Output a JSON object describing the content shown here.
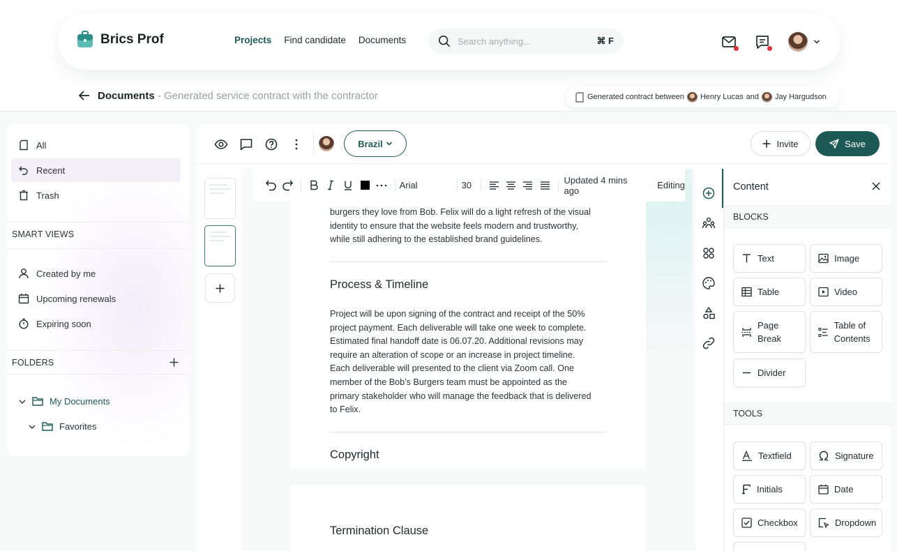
{
  "app": {
    "brand": "Brics Prof",
    "nav": [
      "Projects",
      "Find candidate",
      "Documents"
    ],
    "nav_active": 0,
    "search_placeholder": "Search anything...",
    "search_shortcut": "⌘ F"
  },
  "breadcrumb": {
    "title": "Documents",
    "subtitle": " - Generated service contract with the contractor"
  },
  "contract": {
    "prefix": "Generated contract between",
    "person1": "Henry Lucas",
    "and": "and",
    "person2": "Jay Hargudson"
  },
  "sidebar": {
    "items": [
      "All",
      "Recent",
      "Trash"
    ],
    "active": 1,
    "smart_views_title": "SMART VIEWS",
    "smart_views": [
      "Created by me",
      "Upcoming renewals",
      "Expiring soon"
    ],
    "folders_title": "FOLDERS",
    "folders": [
      "My Documents",
      "Favorites"
    ]
  },
  "toolbar": {
    "country": "Brazil",
    "invite": "Invite",
    "save": "Save"
  },
  "format_bar": {
    "font": "Arial",
    "size": "30",
    "updated": "Updated 4 mins ago",
    "mode": "Editing"
  },
  "document": {
    "intro_lines": [
      "burgers they love from Bob. Felix will do a light refresh of the visual",
      "identity to ensure that the website feels modern and trustworthy,",
      "while still adhering to the established brand guidelines."
    ],
    "section1_title": "Process & Timeline",
    "section1_lines": [
      "Project will be upon signing of the contract and receipt of the 50%",
      "project payment. Each deliverable will take one week to complete.",
      "Estimated final handoff date is 06.07.20. Additional revisions may",
      "require an alteration of scope or an increase in project timeline.",
      "Each deliverable will presented to the client via Zoom call. One",
      "member of the Bob’s Burgers team must be appointed as the",
      "primary stakeholder who will manage the feedback that is delivered",
      "to Felix."
    ],
    "section2_title": "Copyright",
    "section3_title": "Termination Clause"
  },
  "panel": {
    "title": "Content",
    "blocks_title": "BLOCKS",
    "blocks": [
      "Text",
      "Image",
      "Table",
      "Video",
      "Page Break",
      "Table of Contents",
      "Divider"
    ],
    "tools_title": "TOOLS",
    "tools": [
      "Textfield",
      "Signature",
      "Initials",
      "Date",
      "Checkbox",
      "Dropdown"
    ]
  },
  "colors": {
    "accent": "#1d5a56",
    "notification": "#e0303a"
  }
}
